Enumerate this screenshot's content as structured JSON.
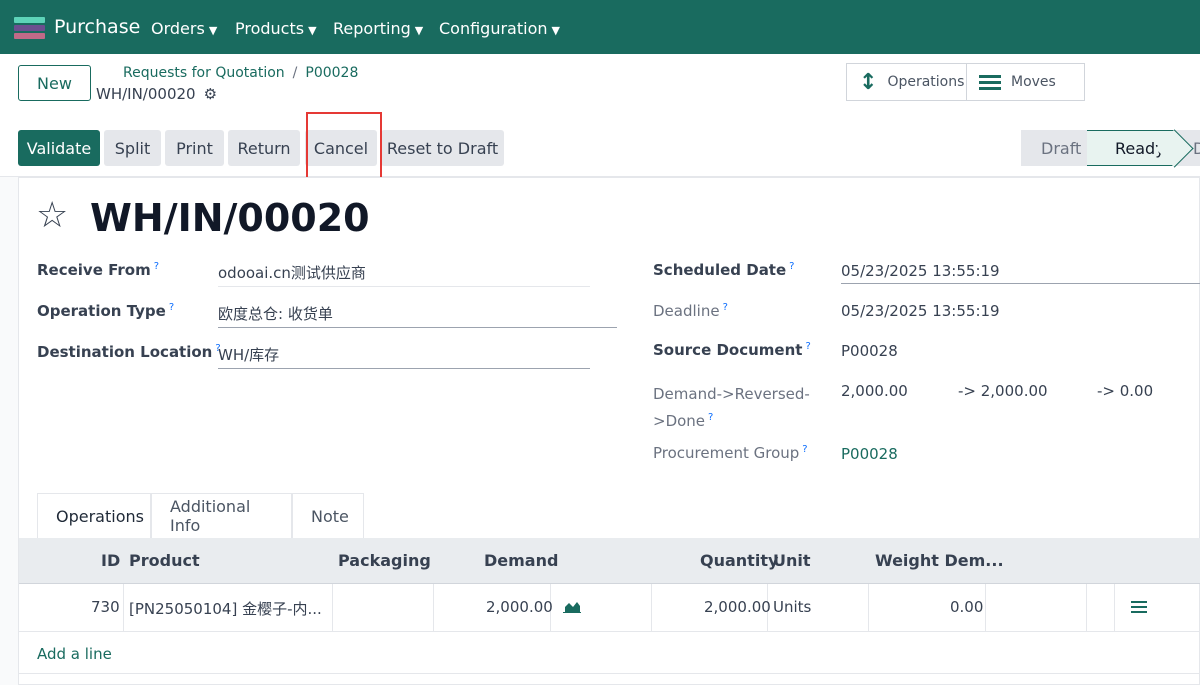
{
  "app": {
    "name": "Purchase"
  },
  "nav": {
    "menus": [
      "Orders",
      "Products",
      "Reporting",
      "Configuration"
    ]
  },
  "control": {
    "new_label": "New",
    "breadcrumb": [
      "Requests for Quotation",
      "P00028"
    ],
    "record_name": "WH/IN/00020",
    "smart_buttons": [
      "Operations",
      "Moves"
    ]
  },
  "actions": [
    "Validate",
    "Split",
    "Print",
    "Return",
    "Cancel",
    "Reset to Draft"
  ],
  "status": {
    "stages": [
      "Draft",
      "Ready",
      "D"
    ],
    "current": "Ready"
  },
  "record": {
    "title": "WH/IN/00020",
    "receive_from": {
      "label": "Receive From",
      "value": "odooai.cn测试供应商"
    },
    "operation_type": {
      "label": "Operation Type",
      "value": "欧度总仓: 收货单"
    },
    "destination_location": {
      "label": "Destination Location",
      "value": "WH/库存"
    },
    "scheduled_date": {
      "label": "Scheduled Date",
      "value": "05/23/2025 13:55:19"
    },
    "deadline": {
      "label": "Deadline",
      "value": "05/23/2025 13:55:19"
    },
    "source_document": {
      "label": "Source Document",
      "value": "P00028"
    },
    "demand_reversed_done": {
      "label_line1": "Demand->Reversed-",
      "label_line2": ">Done",
      "demand": "2,000.00",
      "reversed": "-> 2,000.00",
      "done": "-> 0.00"
    },
    "procurement_group": {
      "label": "Procurement Group",
      "value": "P00028"
    },
    "help_mark": "?"
  },
  "tabs": [
    "Operations",
    "Additional Info",
    "Note"
  ],
  "table": {
    "headers": {
      "id": "ID",
      "product": "Product",
      "packaging": "Packaging",
      "demand": "Demand",
      "quantity": "Quantity",
      "unit": "Unit",
      "weight": "Weight Dem..."
    },
    "rows": [
      {
        "id": "730",
        "product": "[PN25050104] 金樱子-内...",
        "packaging": "",
        "demand": "2,000.00",
        "quantity": "2,000.00",
        "unit": "Units",
        "weight": "0.00"
      }
    ],
    "add_line": "Add a line"
  },
  "colors": {
    "brand": "#196b5f",
    "highlight": "#e53935",
    "help": "#0d6efd"
  },
  "icons": [
    "app-logo",
    "caret-down-icon",
    "gear-icon",
    "arrows-vertical-icon",
    "list-icon",
    "star-icon",
    "forecast-chart-icon"
  ]
}
